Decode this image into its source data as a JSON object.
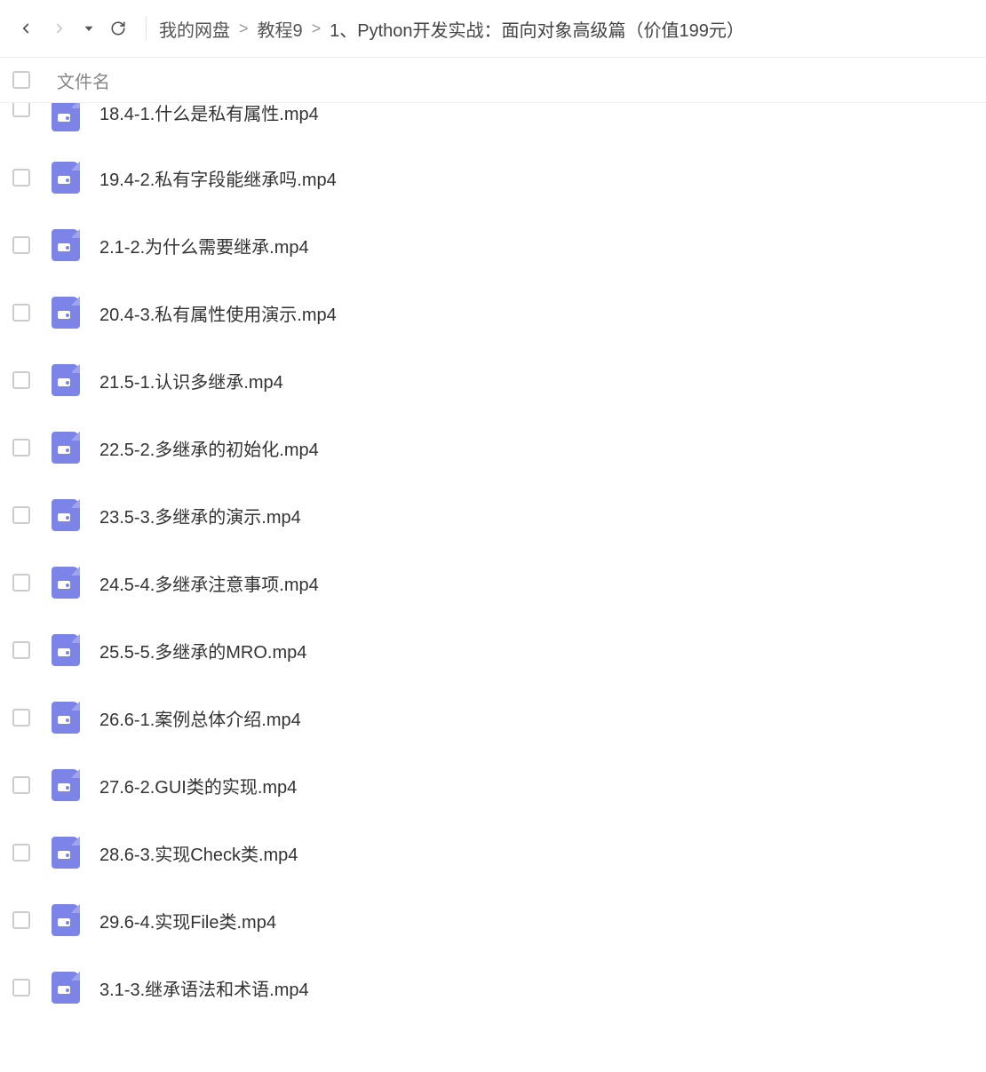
{
  "breadcrumb": {
    "items": [
      {
        "label": "我的网盘"
      },
      {
        "label": "教程9"
      },
      {
        "label": "1、Python开发实战：面向对象高级篇（价值199元）"
      }
    ]
  },
  "header": {
    "filename_label": "文件名"
  },
  "files": [
    {
      "name": "18.4-1.什么是私有属性.mp4"
    },
    {
      "name": "19.4-2.私有字段能继承吗.mp4"
    },
    {
      "name": "2.1-2.为什么需要继承.mp4"
    },
    {
      "name": "20.4-3.私有属性使用演示.mp4"
    },
    {
      "name": "21.5-1.认识多继承.mp4"
    },
    {
      "name": "22.5-2.多继承的初始化.mp4"
    },
    {
      "name": "23.5-3.多继承的演示.mp4"
    },
    {
      "name": "24.5-4.多继承注意事项.mp4"
    },
    {
      "name": "25.5-5.多继承的MRO.mp4"
    },
    {
      "name": "26.6-1.案例总体介绍.mp4"
    },
    {
      "name": "27.6-2.GUI类的实现.mp4"
    },
    {
      "name": "28.6-3.实现Check类.mp4"
    },
    {
      "name": "29.6-4.实现File类.mp4"
    },
    {
      "name": "3.1-3.继承语法和术语.mp4"
    }
  ]
}
